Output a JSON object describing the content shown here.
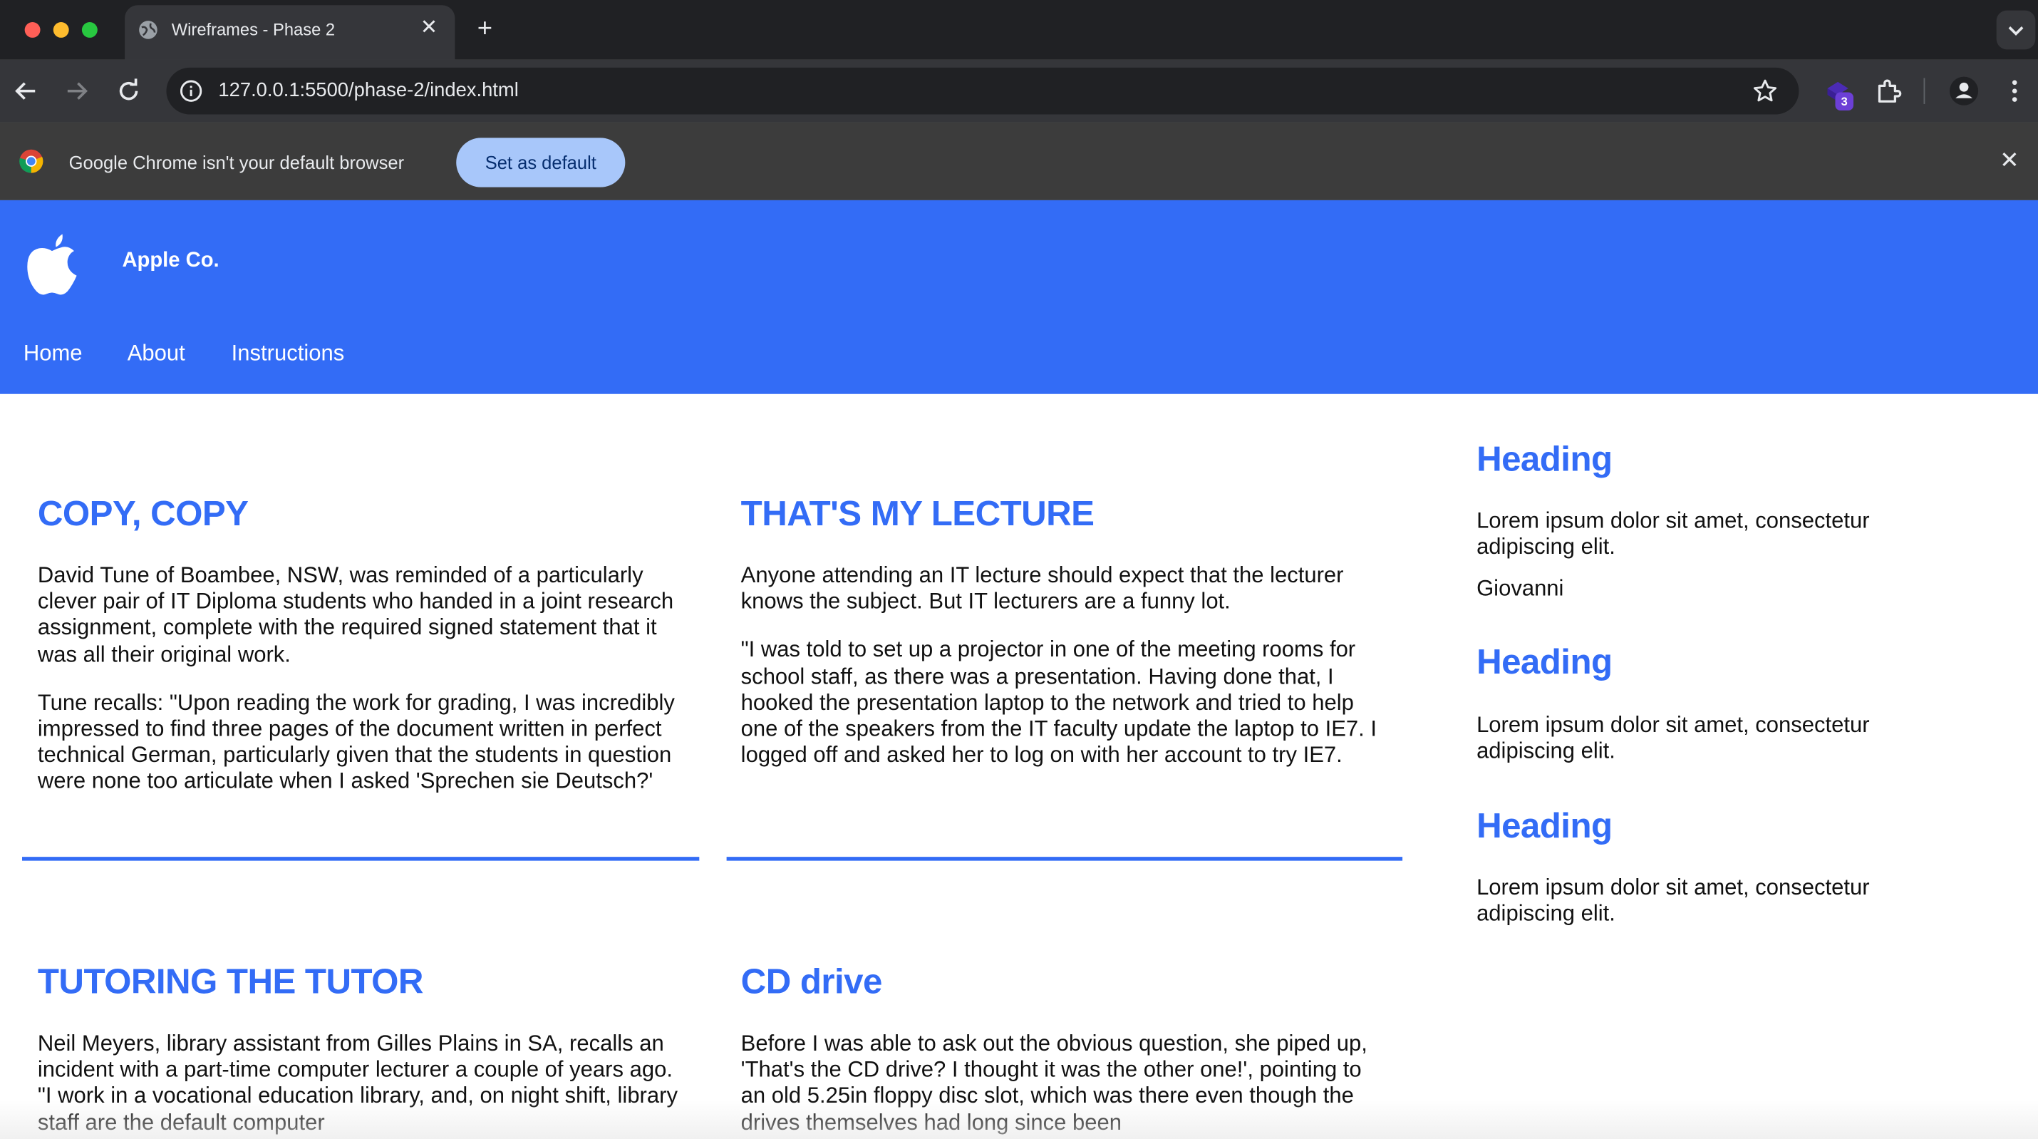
{
  "browser": {
    "tab_title": "Wireframes - Phase 2",
    "url": "127.0.0.1:5500/phase-2/index.html",
    "extension_badge": "3",
    "infobar_text": "Google Chrome isn't your default browser",
    "set_default_label": "Set as default"
  },
  "header": {
    "brand": "Apple Co.",
    "nav": [
      "Home",
      "About",
      "Instructions"
    ]
  },
  "articles": [
    {
      "title": "COPY, COPY",
      "paragraphs": [
        "David Tune of Boambee, NSW, was reminded of a particularly clever pair of IT Diploma students who handed in a joint research assignment, complete with the required signed statement that it was all their original work.",
        "Tune recalls: \"Upon reading the work for grading, I was incredibly impressed to find three pages of the document written in perfect technical German, particularly given that the students in question were none too articulate when I asked 'Sprechen sie Deutsch?'"
      ]
    },
    {
      "title": "THAT'S MY LECTURE",
      "paragraphs": [
        "Anyone attending an IT lecture should expect that the lecturer knows the subject. But IT lecturers are a funny lot.",
        "\"I was told to set up a projector in one of the meeting rooms for school staff, as there was a presentation. Having done that, I hooked the presentation laptop to the network and tried to help one of the speakers from the IT faculty update the laptop to IE7. I logged off and asked her to log on with her account to try IE7."
      ]
    },
    {
      "title": "TUTORING THE TUTOR",
      "paragraphs": [
        "Neil Meyers, library assistant from Gilles Plains in SA, recalls an incident with a part-time computer lecturer a couple of years ago. \"I work in a vocational education library, and, on night shift, library staff are the default computer"
      ]
    },
    {
      "title": "CD drive",
      "paragraphs": [
        "Before I was able to ask out the obvious question, she piped up, 'That's the CD drive? I thought it was the other one!', pointing to an old 5.25in floppy disc slot, which was there even though the drives themselves had long since been"
      ]
    }
  ],
  "sidebar": [
    {
      "heading": "Heading",
      "text": "Lorem ipsum dolor sit amet, consectetur adipiscing elit.",
      "extra": "Giovanni"
    },
    {
      "heading": "Heading",
      "text": "Lorem ipsum dolor sit amet, consectetur adipiscing elit."
    },
    {
      "heading": "Heading",
      "text": "Lorem ipsum dolor sit amet, consectetur adipiscing elit."
    }
  ],
  "colors": {
    "accent": "#336cf6",
    "tabbar": "#202124",
    "toolbar": "#35363a",
    "infobar": "#3c3c3c",
    "set_default_bg": "#a8c7fa"
  }
}
